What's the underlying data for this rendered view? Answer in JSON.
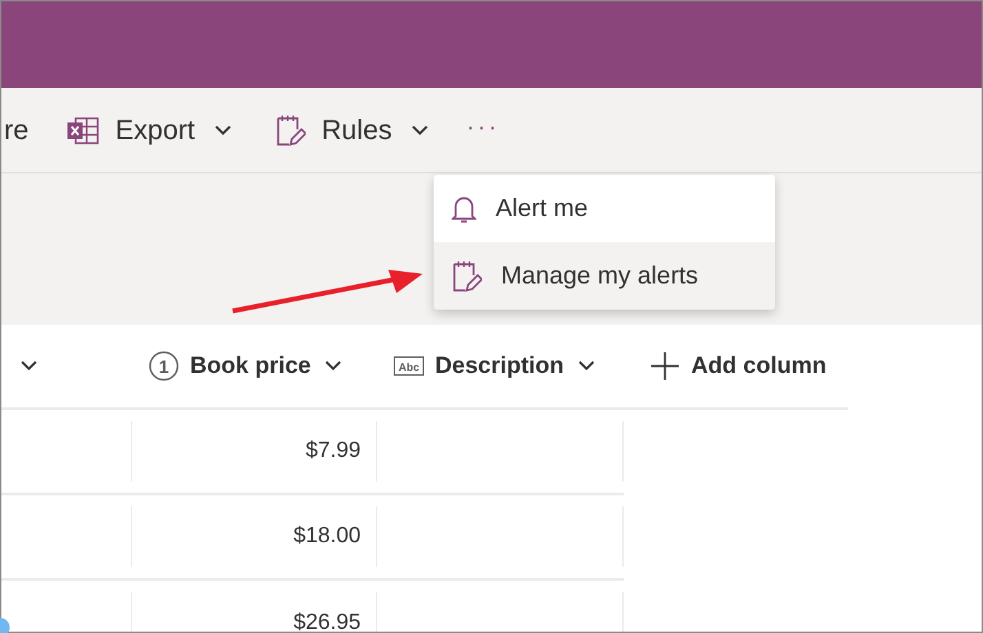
{
  "toolbar": {
    "items": [
      {
        "label": "re",
        "kind": "text"
      },
      {
        "label": "Export",
        "kind": "export"
      },
      {
        "label": "Rules",
        "kind": "rules"
      },
      {
        "label": "···",
        "kind": "more"
      }
    ]
  },
  "menu": {
    "items": [
      {
        "label": "Alert me",
        "kind": "bell",
        "selected": false
      },
      {
        "label": "Manage my alerts",
        "kind": "rules",
        "selected": true
      }
    ]
  },
  "table": {
    "columns": [
      {
        "kind": "partial"
      },
      {
        "label": "Book price",
        "kind": "number",
        "icon_text": "1"
      },
      {
        "label": "Description",
        "kind": "text",
        "icon_text": "Abc"
      },
      {
        "label": "Add column",
        "kind": "add"
      }
    ],
    "rows": [
      [
        "$7.99"
      ],
      [
        "$18.00"
      ],
      [
        "$26.95"
      ]
    ]
  }
}
